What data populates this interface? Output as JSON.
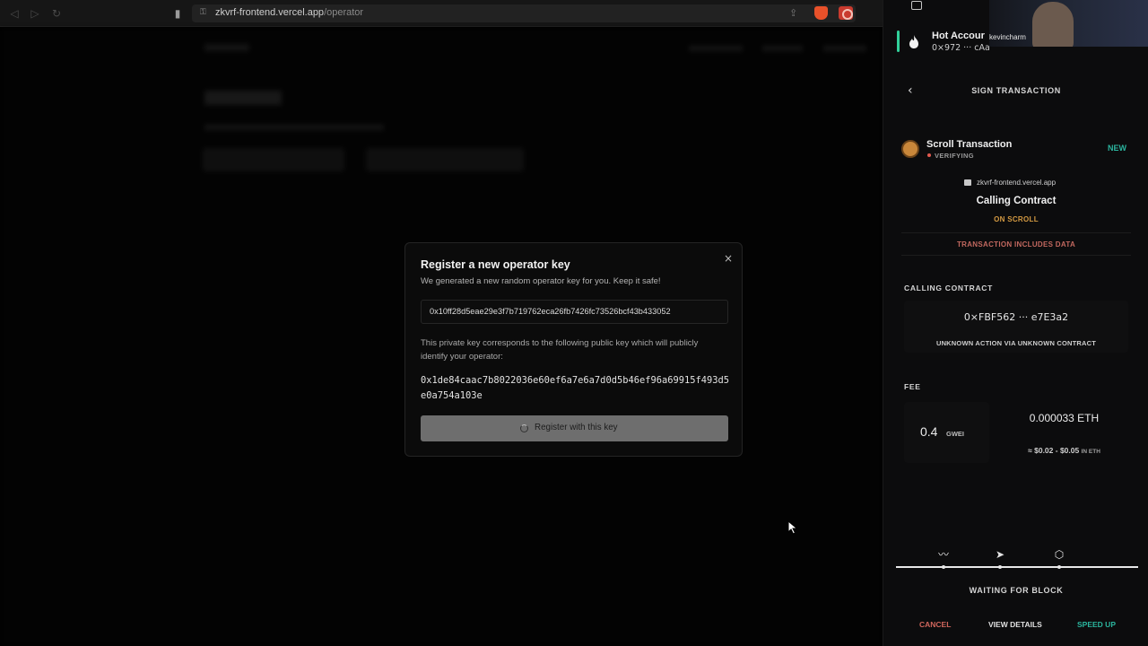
{
  "browser": {
    "url_host": "zkvrf-frontend.vercel.app",
    "url_path": "/operator"
  },
  "modal": {
    "title": "Register a new operator key",
    "subtitle": "We generated a new random operator key for you. Keep it safe!",
    "private_key": "0x10ff28d5eae29e3f7b719762eca26fb7426fc73526bcf43b433052",
    "public_key_description": "This private key corresponds to the following public key which will publicly identify your operator:",
    "public_key": "0x1de84caac7b8022036e60ef6a7e6a7d0d5b46ef96a69915f493d5e0a754a103e",
    "register_label": "Register with this key",
    "close_glyph": "×"
  },
  "wallet": {
    "account_name": "Hot Accour",
    "account_address": "0×972 ··· cAa",
    "webcam_name": "kevincharm",
    "header_title": "SIGN TRANSACTION",
    "transaction": {
      "name": "Scroll Transaction",
      "status": "VERIFYING",
      "badge": "NEW",
      "dapp_url": "zkvrf-frontend.vercel.app",
      "action_title": "Calling Contract",
      "network": "ON SCROLL",
      "data_notice": "TRANSACTION INCLUDES DATA"
    },
    "calling_contract": {
      "label": "CALLING CONTRACT",
      "address": "0×FBF562 ··· e7E3a2",
      "action": "UNKNOWN ACTION VIA UNKNOWN CONTRACT"
    },
    "fee": {
      "label": "FEE",
      "gas_value": "0.4",
      "gas_unit": "GWEI",
      "eth_value": "0.000033 ETH",
      "usd_range": "≈ $0.02 - $0.05",
      "usd_unit": "IN ETH"
    },
    "progress_status": "WAITING FOR BLOCK",
    "actions": {
      "cancel": "CANCEL",
      "view_details": "VIEW DETAILS",
      "speed_up": "SPEED UP"
    }
  },
  "colors": {
    "accent_green": "#2bb59e",
    "warning_orange": "#d49a42",
    "danger_red": "#d0665c",
    "account_bar": "#31d09a"
  },
  "icons": [
    "back-icon",
    "forward-icon",
    "reload-icon",
    "bookmark-icon",
    "lock-icon",
    "share-icon",
    "brave-icon",
    "extension-icon",
    "panel-icon",
    "flame-icon",
    "close-icon",
    "spinner-icon",
    "chevron-left-icon",
    "scroll-logo-icon",
    "signature-icon",
    "send-icon",
    "block-icon",
    "mouse-cursor-icon"
  ]
}
